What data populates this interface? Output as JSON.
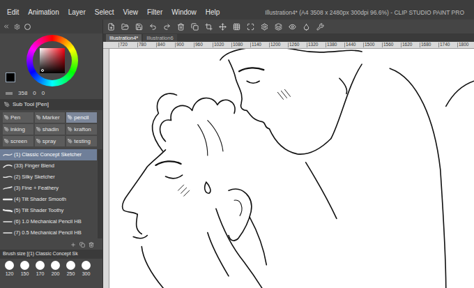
{
  "window": {
    "title": "Illustration4* (A4 3508 x 2480px 300dpi 96.6%) - CLIP STUDIO PAINT PRO"
  },
  "menu": [
    "Edit",
    "Animation",
    "Layer",
    "Select",
    "View",
    "Filter",
    "Window",
    "Help"
  ],
  "document_tabs": [
    {
      "label": "Illustration4*",
      "selected": true
    },
    {
      "label": "Illustration6",
      "selected": false
    }
  ],
  "color": {
    "readout": [
      "358",
      "0",
      "0"
    ]
  },
  "sub_tool": {
    "title": "Sub Tool [Pen]",
    "groups": [
      {
        "label": "Pen",
        "selected": false
      },
      {
        "label": "Marker",
        "selected": false
      },
      {
        "label": "pencil",
        "selected": true
      },
      {
        "label": "inking",
        "selected": false
      },
      {
        "label": "shadin",
        "selected": false
      },
      {
        "label": "krafton",
        "selected": false
      },
      {
        "label": "screen",
        "selected": false
      },
      {
        "label": "spray",
        "selected": false
      },
      {
        "label": "testing",
        "selected": false
      }
    ]
  },
  "brushes": [
    {
      "label": "(1) Classic Concept Sketcher",
      "selected": true
    },
    {
      "label": "(33) Finger Blend",
      "selected": false
    },
    {
      "label": "(2) Silky Sketcher",
      "selected": false
    },
    {
      "label": "(3) Fine + Feathery",
      "selected": false
    },
    {
      "label": "(4) Tilt Shader Smooth",
      "selected": false
    },
    {
      "label": "(5) Tilt Shader Toothy",
      "selected": false
    },
    {
      "label": "(6) 1.0 Mechanical Pencil HB",
      "selected": false
    },
    {
      "label": "(7) 0.5 Mechanical Pencil HB",
      "selected": false
    }
  ],
  "brush_size": {
    "title": "Brush size [(1) Classic Concept Sk",
    "sizes": [
      "120",
      "150",
      "170",
      "200",
      "250",
      "300"
    ]
  },
  "ruler": [
    "720",
    "780",
    "840",
    "900",
    "960",
    "1020",
    "1080",
    "1140",
    "1200",
    "1260",
    "1320",
    "1380",
    "1440",
    "1500",
    "1560",
    "1620",
    "1680",
    "1740",
    "1800"
  ]
}
